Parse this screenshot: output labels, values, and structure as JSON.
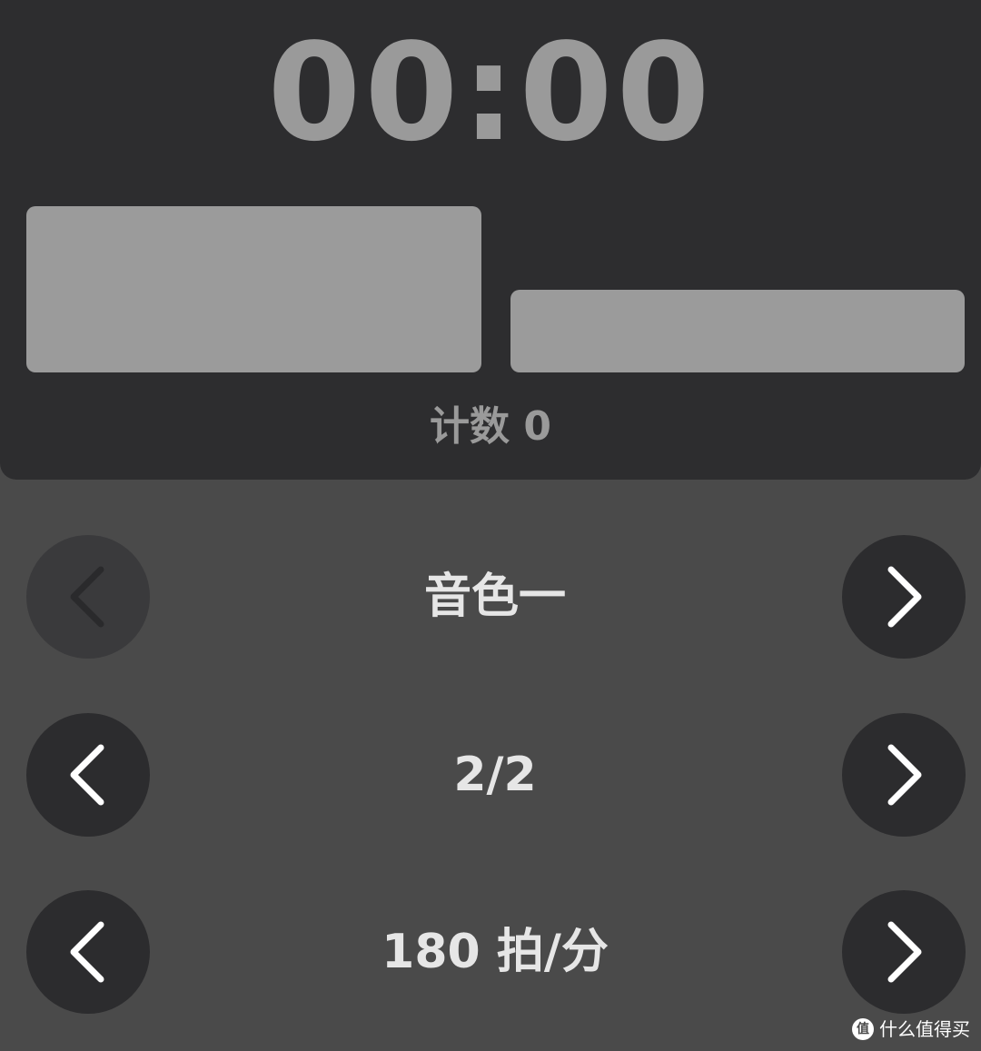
{
  "timer": {
    "display": "00:00"
  },
  "beat_indicator": {
    "levels": [
      1.0,
      0.5
    ]
  },
  "counter": {
    "label": "计数 0"
  },
  "sound_selector": {
    "label": "音色一",
    "prev_enabled": false,
    "next_enabled": true,
    "prev_icon": "chevron-left-icon",
    "next_icon": "chevron-right-icon"
  },
  "meter_selector": {
    "label": "2/2",
    "prev_icon": "chevron-left-icon",
    "next_icon": "chevron-right-icon"
  },
  "tempo_selector": {
    "label": "180 拍/分",
    "prev_icon": "chevron-left-icon",
    "next_icon": "chevron-right-icon"
  },
  "watermark": {
    "logo_text": "值",
    "text": "什么值得买"
  },
  "colors": {
    "background": "#4a4a4a",
    "top_panel": "#2d2d2f",
    "timer_text": "#9a9a9a",
    "beat_block": "#9b9b9b",
    "button_bg": "#2c2c2e",
    "button_disabled_bg": "#3a3a3c",
    "icon_enabled": "#ffffff",
    "icon_disabled": "#2a2a2c",
    "label_text": "#e6e6e6"
  }
}
